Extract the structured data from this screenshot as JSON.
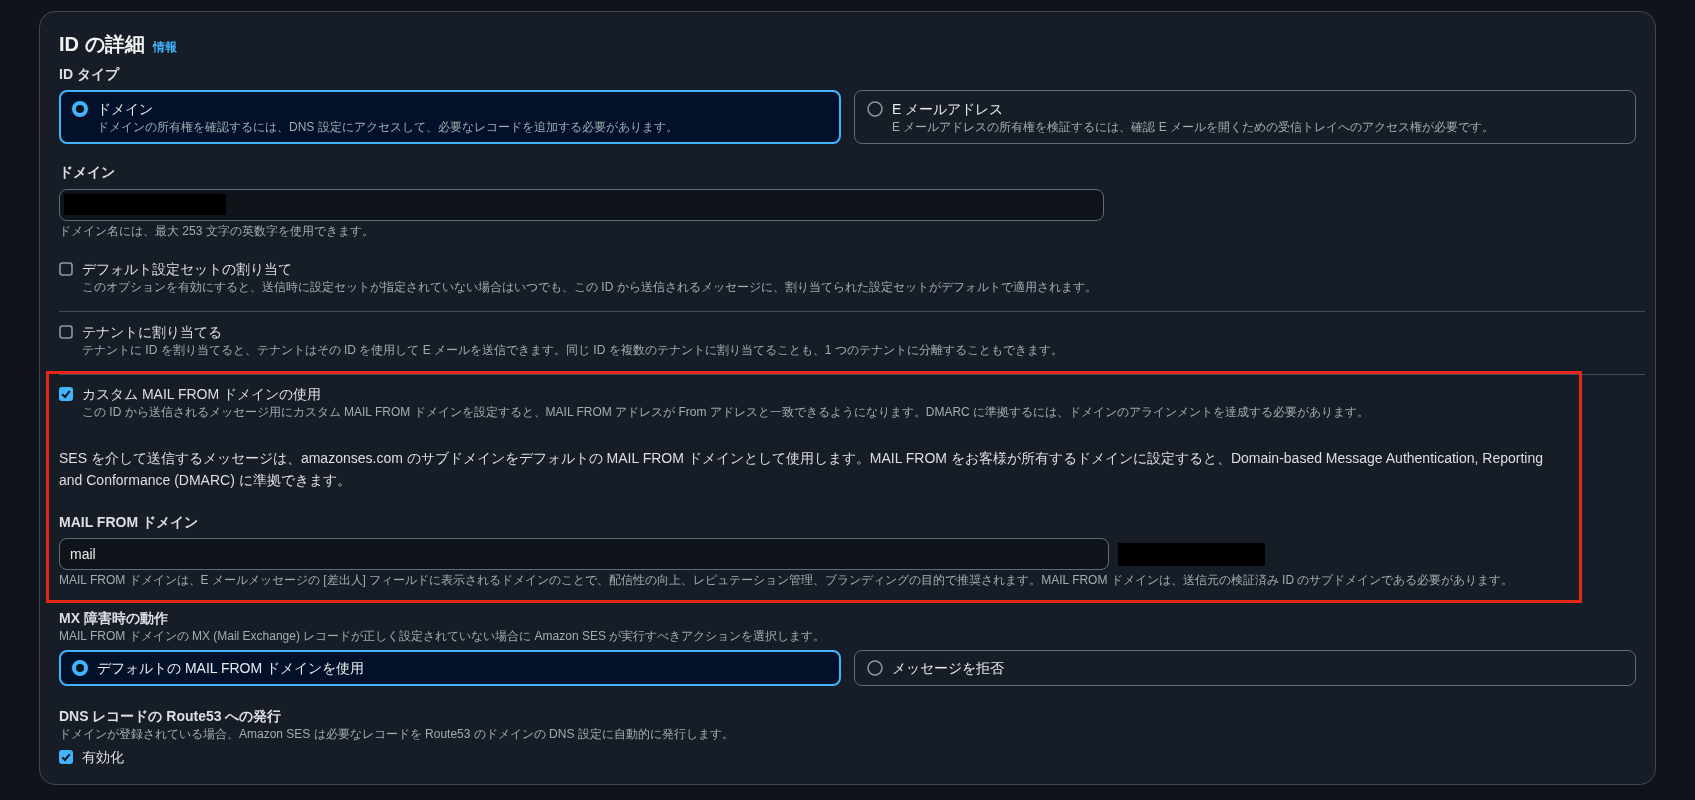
{
  "section": {
    "title": "ID の詳細",
    "info_link": "情報"
  },
  "id_type": {
    "label": "ID タイプ",
    "options": [
      {
        "label": "ドメイン",
        "description": "ドメインの所有権を確認するには、DNS 設定にアクセスして、必要なレコードを追加する必要があります。",
        "selected": true
      },
      {
        "label": "E メールアドレス",
        "description": "E メールアドレスの所有権を検証するには、確認 E メールを開くための受信トレイへのアクセス権が必要です。",
        "selected": false
      }
    ]
  },
  "domain": {
    "label": "ドメイン",
    "redacted": true,
    "hint": "ドメイン名には、最大 253 文字の英数字を使用できます。"
  },
  "options": [
    {
      "label": "デフォルト設定セットの割り当て",
      "description": "このオプションを有効にすると、送信時に設定セットが指定されていない場合はいつでも、この ID から送信されるメッセージに、割り当てられた設定セットがデフォルトで適用されます。",
      "checked": false
    },
    {
      "label": "テナントに割り当てる",
      "description": "テナントに ID を割り当てると、テナントはその ID を使用して E メールを送信できます。同じ ID を複数のテナントに割り当てることも、1 つのテナントに分離することもできます。",
      "checked": false
    }
  ],
  "custom_mail_from": {
    "highlighted": true,
    "label": "カスタム MAIL FROM ドメインの使用",
    "description": "この ID から送信されるメッセージ用にカスタム MAIL FROM ドメインを設定すると、MAIL FROM アドレスが From アドレスと一致できるようになります。DMARC に準拠するには、ドメインのアラインメントを達成する必要があります。",
    "checked": true,
    "note": "SES を介して送信するメッセージは、amazonses.com のサブドメインをデフォルトの MAIL FROM ドメインとして使用します。MAIL FROM をお客様が所有するドメインに設定すると、Domain-based Message Authentication, Reporting and Conformance (DMARC) に準拠できます。",
    "field": {
      "label": "MAIL FROM ドメイン",
      "value": "mail",
      "suffix_redacted": true,
      "hint": "MAIL FROM ドメインは、E メールメッセージの [差出人] フィールドに表示されるドメインのことで、配信性の向上、レピュテーション管理、ブランディングの目的で推奨されます。MAIL FROM ドメインは、送信元の検証済み ID のサブドメインである必要があります。"
    }
  },
  "mx_failure": {
    "label": "MX 障害時の動作",
    "description": "MAIL FROM ドメインの MX (Mail Exchange) レコードが正しく設定されていない場合に Amazon SES が実行すべきアクションを選択します。",
    "options": [
      {
        "label": "デフォルトの MAIL FROM ドメインを使用",
        "selected": true
      },
      {
        "label": "メッセージを拒否",
        "selected": false
      }
    ]
  },
  "route53": {
    "label": "DNS レコードの Route53 への発行",
    "description": "ドメインが登録されている場合、Amazon SES は必要なレコードを Route53 のドメインの DNS 設定に自動的に発行します。",
    "checkbox": {
      "label": "有効化",
      "checked": true
    }
  }
}
